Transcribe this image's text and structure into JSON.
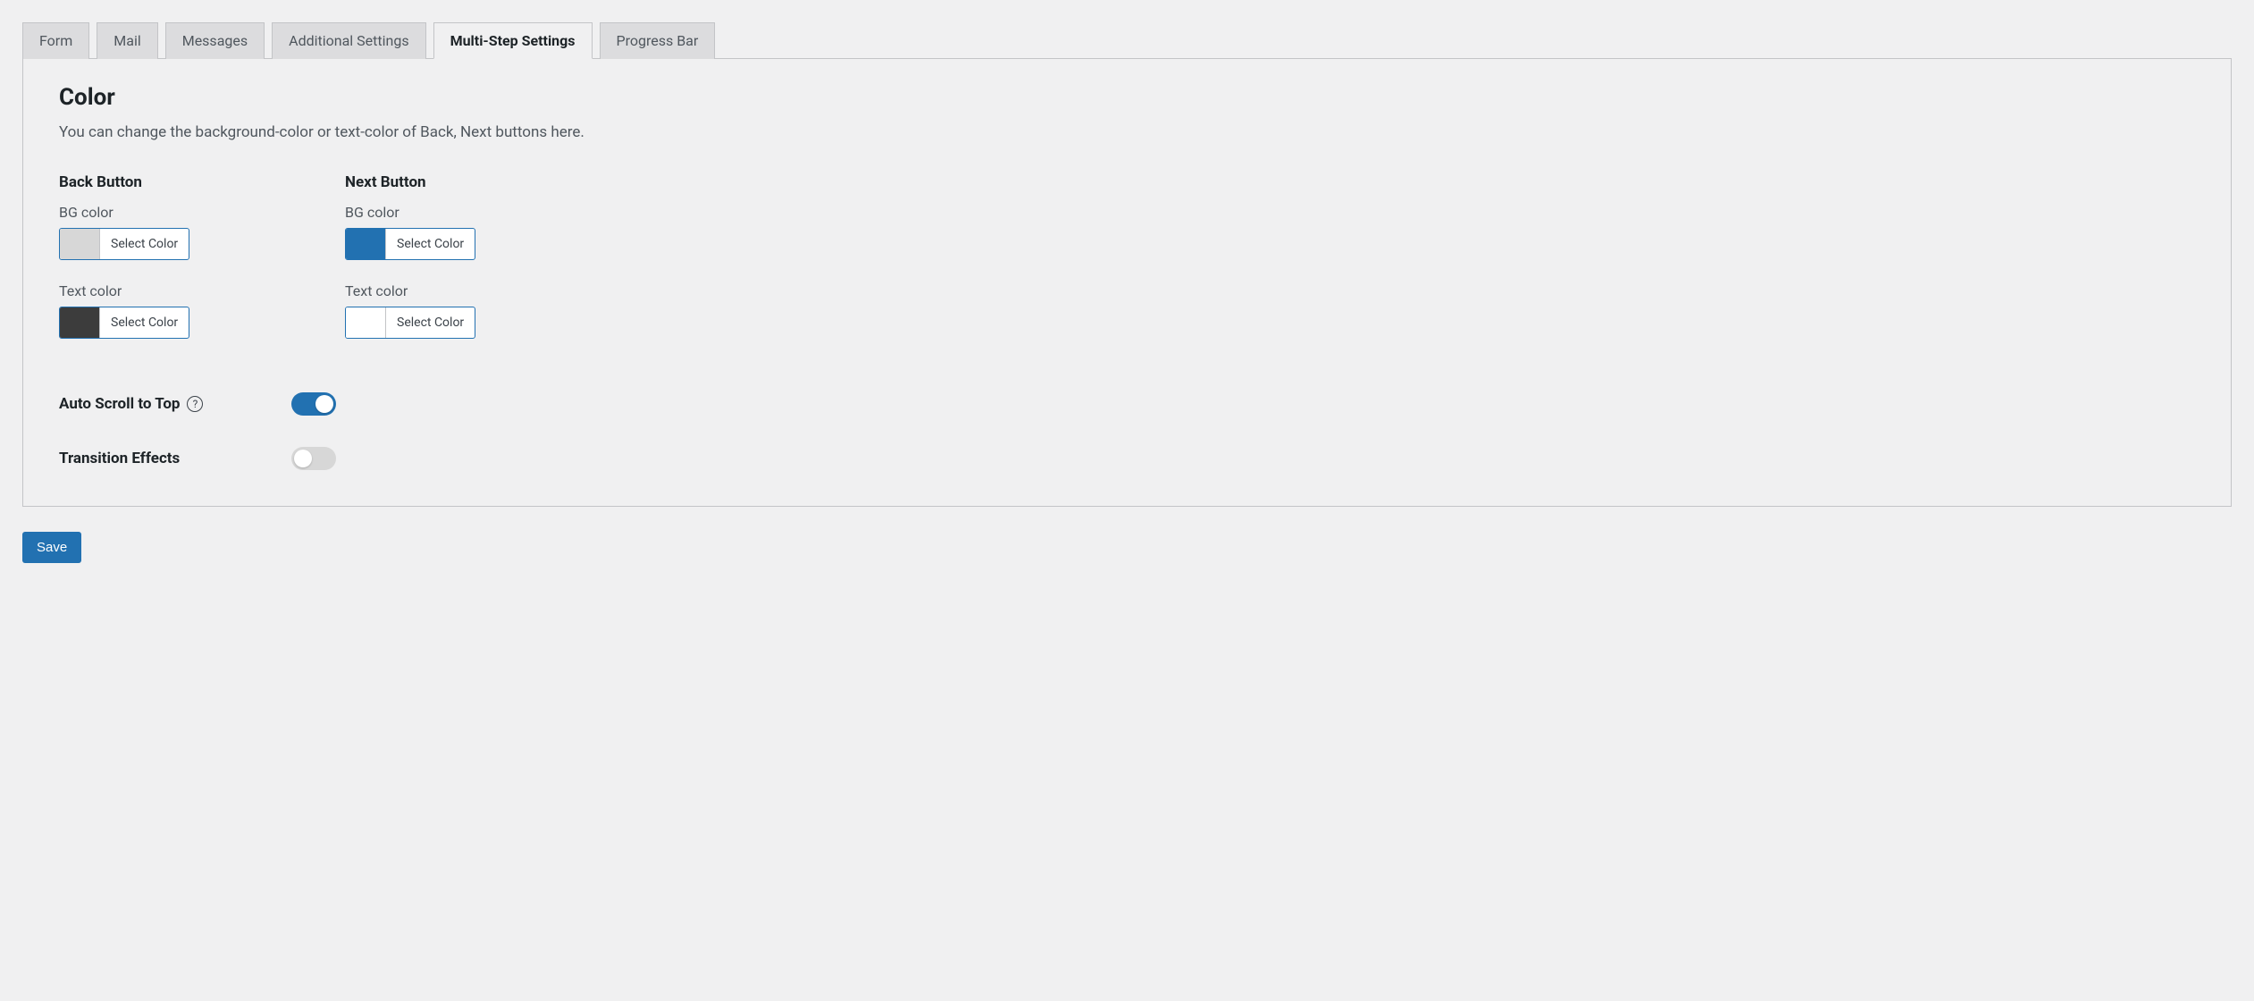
{
  "tabs": [
    {
      "label": "Form",
      "active": false
    },
    {
      "label": "Mail",
      "active": false
    },
    {
      "label": "Messages",
      "active": false
    },
    {
      "label": "Additional Settings",
      "active": false
    },
    {
      "label": "Multi-Step Settings",
      "active": true
    },
    {
      "label": "Progress Bar",
      "active": false
    }
  ],
  "section": {
    "title": "Color",
    "description": "You can change the background-color or text-color of Back, Next buttons here."
  },
  "back_button": {
    "title": "Back Button",
    "bg_label": "BG color",
    "bg_color": "#d7d7d7",
    "text_label": "Text color",
    "text_color": "#3c3c3c",
    "select_label": "Select Color"
  },
  "next_button": {
    "title": "Next Button",
    "bg_label": "BG color",
    "bg_color": "#2271b1",
    "text_label": "Text color",
    "text_color": "#ffffff",
    "select_label": "Select Color"
  },
  "auto_scroll": {
    "label": "Auto Scroll to Top",
    "enabled": true,
    "help": "?"
  },
  "transition": {
    "label": "Transition Effects",
    "enabled": false
  },
  "save_label": "Save"
}
